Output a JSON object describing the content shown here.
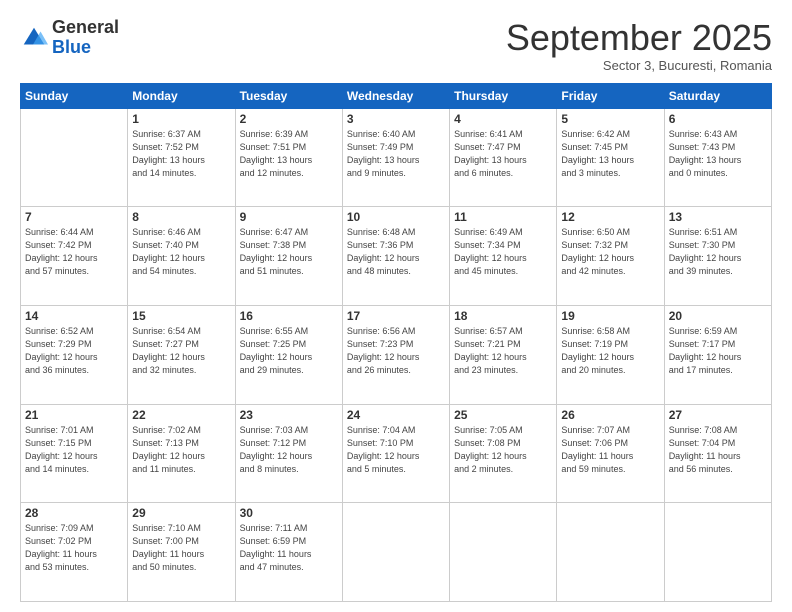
{
  "logo": {
    "general": "General",
    "blue": "Blue"
  },
  "title": "September 2025",
  "subtitle": "Sector 3, Bucuresti, Romania",
  "weekdays": [
    "Sunday",
    "Monday",
    "Tuesday",
    "Wednesday",
    "Thursday",
    "Friday",
    "Saturday"
  ],
  "weeks": [
    [
      {
        "day": "",
        "info": ""
      },
      {
        "day": "1",
        "info": "Sunrise: 6:37 AM\nSunset: 7:52 PM\nDaylight: 13 hours\nand 14 minutes."
      },
      {
        "day": "2",
        "info": "Sunrise: 6:39 AM\nSunset: 7:51 PM\nDaylight: 13 hours\nand 12 minutes."
      },
      {
        "day": "3",
        "info": "Sunrise: 6:40 AM\nSunset: 7:49 PM\nDaylight: 13 hours\nand 9 minutes."
      },
      {
        "day": "4",
        "info": "Sunrise: 6:41 AM\nSunset: 7:47 PM\nDaylight: 13 hours\nand 6 minutes."
      },
      {
        "day": "5",
        "info": "Sunrise: 6:42 AM\nSunset: 7:45 PM\nDaylight: 13 hours\nand 3 minutes."
      },
      {
        "day": "6",
        "info": "Sunrise: 6:43 AM\nSunset: 7:43 PM\nDaylight: 13 hours\nand 0 minutes."
      }
    ],
    [
      {
        "day": "7",
        "info": "Sunrise: 6:44 AM\nSunset: 7:42 PM\nDaylight: 12 hours\nand 57 minutes."
      },
      {
        "day": "8",
        "info": "Sunrise: 6:46 AM\nSunset: 7:40 PM\nDaylight: 12 hours\nand 54 minutes."
      },
      {
        "day": "9",
        "info": "Sunrise: 6:47 AM\nSunset: 7:38 PM\nDaylight: 12 hours\nand 51 minutes."
      },
      {
        "day": "10",
        "info": "Sunrise: 6:48 AM\nSunset: 7:36 PM\nDaylight: 12 hours\nand 48 minutes."
      },
      {
        "day": "11",
        "info": "Sunrise: 6:49 AM\nSunset: 7:34 PM\nDaylight: 12 hours\nand 45 minutes."
      },
      {
        "day": "12",
        "info": "Sunrise: 6:50 AM\nSunset: 7:32 PM\nDaylight: 12 hours\nand 42 minutes."
      },
      {
        "day": "13",
        "info": "Sunrise: 6:51 AM\nSunset: 7:30 PM\nDaylight: 12 hours\nand 39 minutes."
      }
    ],
    [
      {
        "day": "14",
        "info": "Sunrise: 6:52 AM\nSunset: 7:29 PM\nDaylight: 12 hours\nand 36 minutes."
      },
      {
        "day": "15",
        "info": "Sunrise: 6:54 AM\nSunset: 7:27 PM\nDaylight: 12 hours\nand 32 minutes."
      },
      {
        "day": "16",
        "info": "Sunrise: 6:55 AM\nSunset: 7:25 PM\nDaylight: 12 hours\nand 29 minutes."
      },
      {
        "day": "17",
        "info": "Sunrise: 6:56 AM\nSunset: 7:23 PM\nDaylight: 12 hours\nand 26 minutes."
      },
      {
        "day": "18",
        "info": "Sunrise: 6:57 AM\nSunset: 7:21 PM\nDaylight: 12 hours\nand 23 minutes."
      },
      {
        "day": "19",
        "info": "Sunrise: 6:58 AM\nSunset: 7:19 PM\nDaylight: 12 hours\nand 20 minutes."
      },
      {
        "day": "20",
        "info": "Sunrise: 6:59 AM\nSunset: 7:17 PM\nDaylight: 12 hours\nand 17 minutes."
      }
    ],
    [
      {
        "day": "21",
        "info": "Sunrise: 7:01 AM\nSunset: 7:15 PM\nDaylight: 12 hours\nand 14 minutes."
      },
      {
        "day": "22",
        "info": "Sunrise: 7:02 AM\nSunset: 7:13 PM\nDaylight: 12 hours\nand 11 minutes."
      },
      {
        "day": "23",
        "info": "Sunrise: 7:03 AM\nSunset: 7:12 PM\nDaylight: 12 hours\nand 8 minutes."
      },
      {
        "day": "24",
        "info": "Sunrise: 7:04 AM\nSunset: 7:10 PM\nDaylight: 12 hours\nand 5 minutes."
      },
      {
        "day": "25",
        "info": "Sunrise: 7:05 AM\nSunset: 7:08 PM\nDaylight: 12 hours\nand 2 minutes."
      },
      {
        "day": "26",
        "info": "Sunrise: 7:07 AM\nSunset: 7:06 PM\nDaylight: 11 hours\nand 59 minutes."
      },
      {
        "day": "27",
        "info": "Sunrise: 7:08 AM\nSunset: 7:04 PM\nDaylight: 11 hours\nand 56 minutes."
      }
    ],
    [
      {
        "day": "28",
        "info": "Sunrise: 7:09 AM\nSunset: 7:02 PM\nDaylight: 11 hours\nand 53 minutes."
      },
      {
        "day": "29",
        "info": "Sunrise: 7:10 AM\nSunset: 7:00 PM\nDaylight: 11 hours\nand 50 minutes."
      },
      {
        "day": "30",
        "info": "Sunrise: 7:11 AM\nSunset: 6:59 PM\nDaylight: 11 hours\nand 47 minutes."
      },
      {
        "day": "",
        "info": ""
      },
      {
        "day": "",
        "info": ""
      },
      {
        "day": "",
        "info": ""
      },
      {
        "day": "",
        "info": ""
      }
    ]
  ]
}
